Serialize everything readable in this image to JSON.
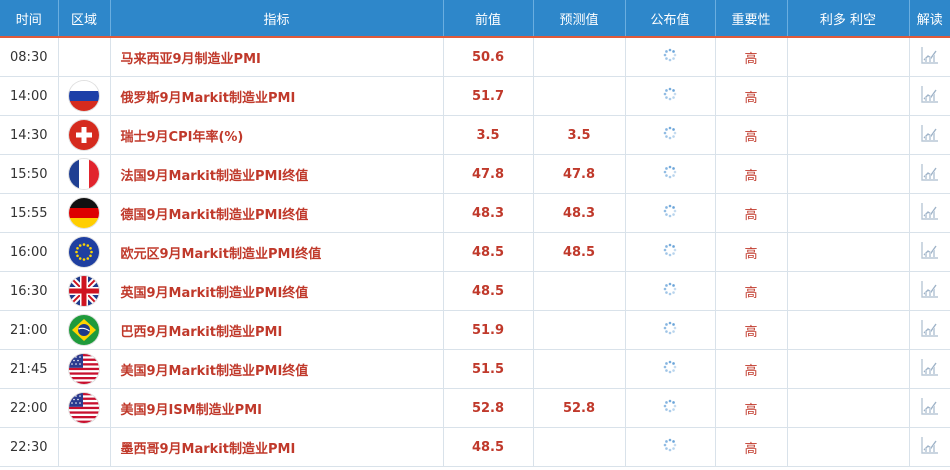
{
  "header": {
    "time": "时间",
    "region": "区域",
    "indicator": "指标",
    "previous": "前值",
    "forecast": "预测值",
    "actual": "公布值",
    "importance": "重要性",
    "impact": "利多 利空",
    "analysis": "解读"
  },
  "colors": {
    "header_bg": "#2e87ca",
    "accent_red": "#c0392b",
    "header_underline": "#e05a3a"
  },
  "rows": [
    {
      "time": "08:30",
      "country": "",
      "indicator": "马来西亚9月制造业PMI",
      "previous": "50.6",
      "forecast": "",
      "actual": "",
      "importance": "高",
      "impact": ""
    },
    {
      "time": "14:00",
      "country": "russia",
      "indicator": "俄罗斯9月Markit制造业PMI",
      "previous": "51.7",
      "forecast": "",
      "actual": "",
      "importance": "高",
      "impact": ""
    },
    {
      "time": "14:30",
      "country": "switzerland",
      "indicator": "瑞士9月CPI年率(%)",
      "previous": "3.5",
      "forecast": "3.5",
      "actual": "",
      "importance": "高",
      "impact": ""
    },
    {
      "time": "15:50",
      "country": "france",
      "indicator": "法国9月Markit制造业PMI终值",
      "previous": "47.8",
      "forecast": "47.8",
      "actual": "",
      "importance": "高",
      "impact": ""
    },
    {
      "time": "15:55",
      "country": "germany",
      "indicator": "德国9月Markit制造业PMI终值",
      "previous": "48.3",
      "forecast": "48.3",
      "actual": "",
      "importance": "高",
      "impact": ""
    },
    {
      "time": "16:00",
      "country": "eu",
      "indicator": "欧元区9月Markit制造业PMI终值",
      "previous": "48.5",
      "forecast": "48.5",
      "actual": "",
      "importance": "高",
      "impact": ""
    },
    {
      "time": "16:30",
      "country": "uk",
      "indicator": "英国9月Markit制造业PMI终值",
      "previous": "48.5",
      "forecast": "",
      "actual": "",
      "importance": "高",
      "impact": ""
    },
    {
      "time": "21:00",
      "country": "brazil",
      "indicator": "巴西9月Markit制造业PMI",
      "previous": "51.9",
      "forecast": "",
      "actual": "",
      "importance": "高",
      "impact": ""
    },
    {
      "time": "21:45",
      "country": "usa",
      "indicator": "美国9月Markit制造业PMI终值",
      "previous": "51.5",
      "forecast": "",
      "actual": "",
      "importance": "高",
      "impact": ""
    },
    {
      "time": "22:00",
      "country": "usa",
      "indicator": "美国9月ISM制造业PMI",
      "previous": "52.8",
      "forecast": "52.8",
      "actual": "",
      "importance": "高",
      "impact": ""
    },
    {
      "time": "22:30",
      "country": "",
      "indicator": "墨西哥9月Markit制造业PMI",
      "previous": "48.5",
      "forecast": "",
      "actual": "",
      "importance": "高",
      "impact": ""
    }
  ]
}
